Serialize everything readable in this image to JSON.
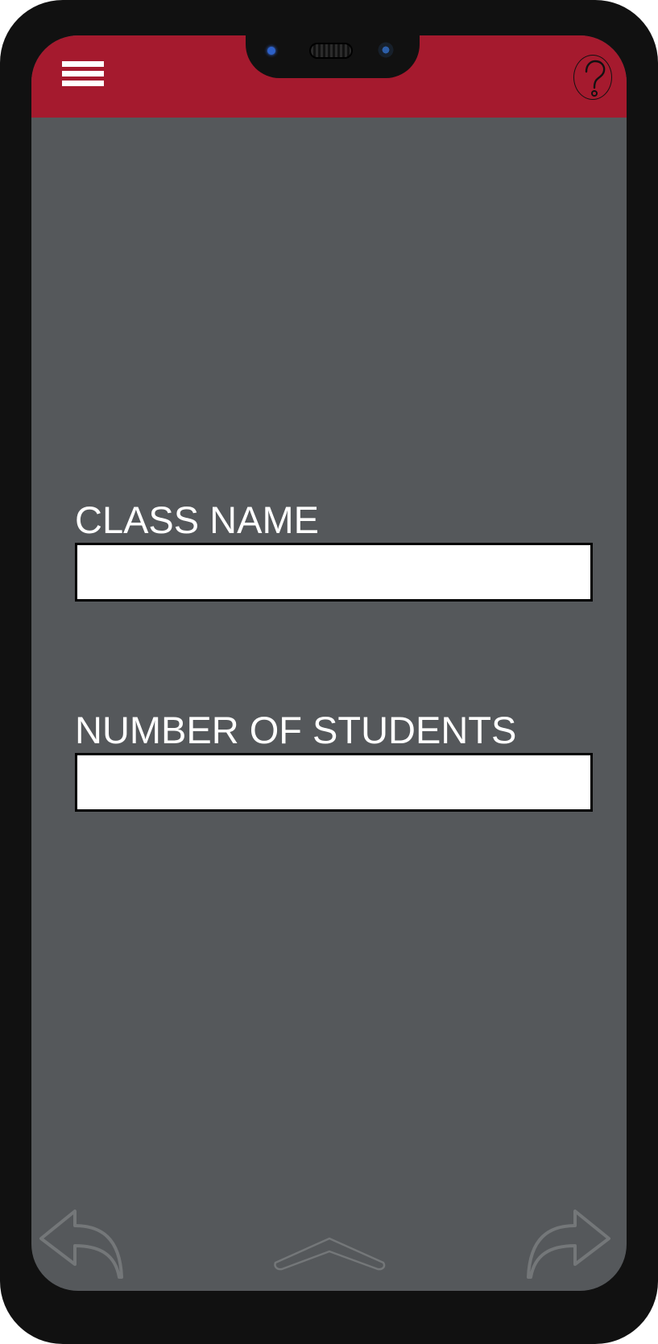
{
  "header": {
    "menu_icon": "hamburger-menu-icon",
    "help_icon": "question-mark-icon",
    "accent_color": "#a51a2e"
  },
  "form": {
    "class_name": {
      "label": "CLASS NAME",
      "value": "",
      "placeholder": ""
    },
    "number_of_students": {
      "label": "NUMBER OF STUDENTS",
      "value": "",
      "placeholder": ""
    }
  },
  "navigation": {
    "back_icon": "back-arrow-icon",
    "home_icon": "chevron-up-icon",
    "forward_icon": "forward-arrow-icon"
  }
}
